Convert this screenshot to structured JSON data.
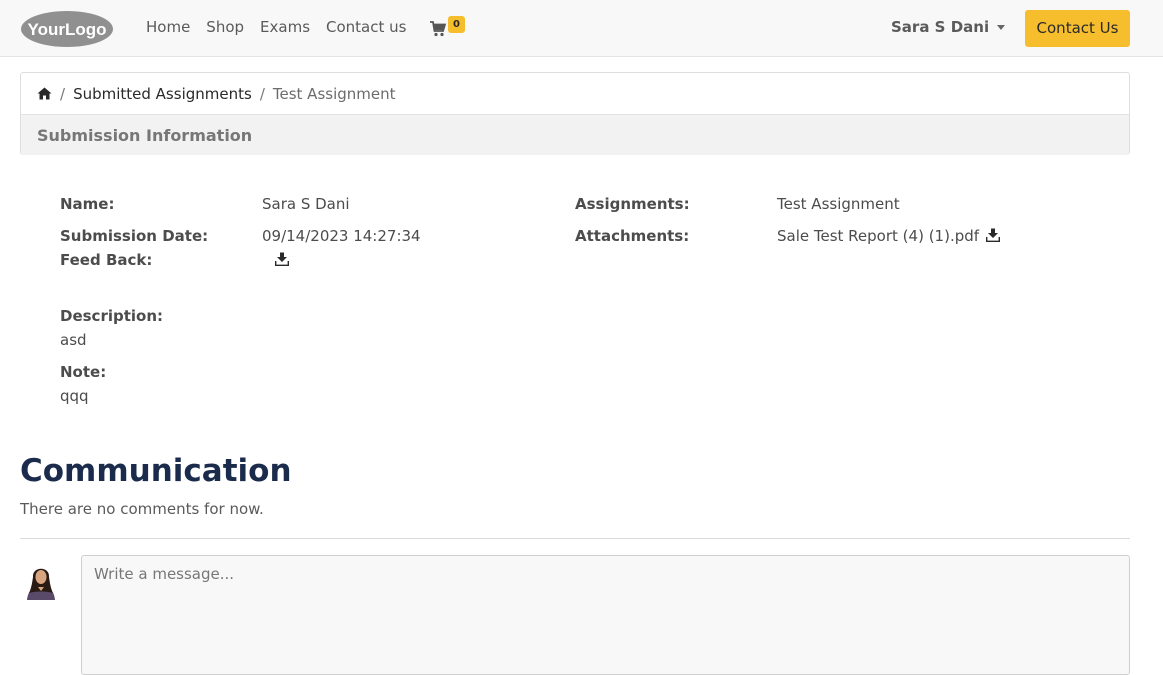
{
  "navbar": {
    "logo_text": "YourLogo",
    "links": [
      "Home",
      "Shop",
      "Exams",
      "Contact us"
    ],
    "cart_count": "0",
    "user_name": "Sara S Dani",
    "contact_button": "Contact Us",
    "accent_color": "#f6be2c"
  },
  "breadcrumb": {
    "home_icon": "home-icon",
    "parent": "Submitted Assignments",
    "current": "Test Assignment"
  },
  "card": {
    "header": "Submission Information"
  },
  "submission": {
    "name_label": "Name:",
    "name_value": "Sara S Dani",
    "date_label": "Submission Date:",
    "date_value": "09/14/2023 14:27:34",
    "feedback_label": "Feed Back:",
    "assignments_label": "Assignments:",
    "assignments_value": "Test Assignment",
    "attachments_label": "Attachments:",
    "attachments_value": "Sale Test Report (4) (1).pdf",
    "description_label": "Description:",
    "description_value": "asd",
    "note_label": "Note:",
    "note_value": "qqq"
  },
  "communication": {
    "title": "Communication",
    "empty_text": "There are no comments for now.",
    "placeholder": "Write a message..."
  }
}
